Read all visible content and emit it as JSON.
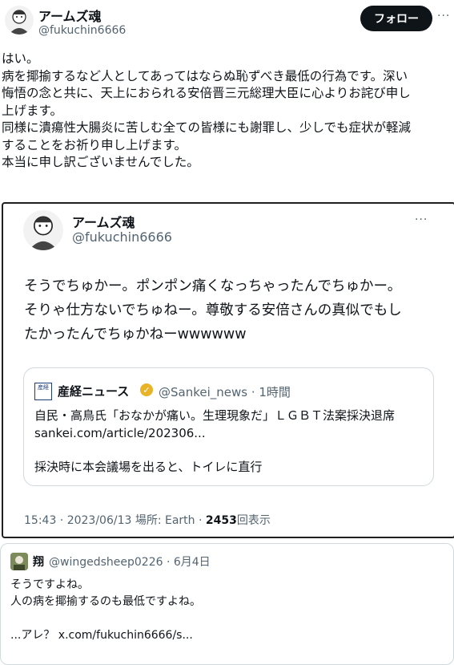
{
  "post": {
    "display_name": "アームズ魂",
    "handle": "@fukuchin6666",
    "follow_label": "フォロー",
    "more_label": "···",
    "text_lines": [
      "はい。",
      "病を揶揄するなど人としてあってはならぬ恥ずべき最低の行為です。深い",
      "悔悟の念と共に、天上におられる安倍晋三元総理大臣に心よりお詫び申し",
      "上げます。",
      "同様に潰瘍性大腸炎に苦しむ全ての皆様にも謝罪し、少しでも症状が軽減",
      "することをお祈り申し上げます。",
      "本当に申し訳ございませんでした。"
    ]
  },
  "embedded": {
    "display_name": "アームズ魂",
    "handle": "@fukuchin6666",
    "more_label": "···",
    "text_lines": [
      "そうでちゅかー。ポンポン痛くなっちゃったんでちゅかー。",
      "そりゃ仕方ないでちゅねー。尊敬する安倍さんの真似でもし",
      "たかったんでちゅかねーwwwwww"
    ],
    "quote": {
      "logo_text": "産経",
      "name": "産経ニュース",
      "handle_time": "@Sankei_news · 1時間",
      "line1": "自民・高鳥氏「おなかが痛い。生理現象だ」ＬＧＢＴ法案採決退席",
      "line2": "sankei.com/article/202306...",
      "line3": "採決時に本会議場を出ると、トイレに直行"
    },
    "meta_prefix": "15:43 · 2023/06/13 場所: Earth · ",
    "views_count": "2453",
    "views_label": "回表示"
  },
  "reply": {
    "name": "翔",
    "handle_date": "@wingedsheep0226 · 6月4日",
    "line1": "そうですよね。",
    "line2": "人の病を揶揄するのも最低ですよね。",
    "line3": "...アレ？ x.com/fukuchin6666/s..."
  }
}
